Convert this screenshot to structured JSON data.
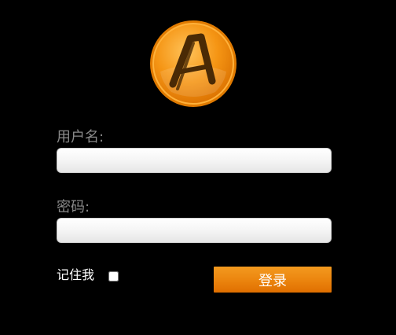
{
  "logo": {
    "icon": "letter-a-orange-logo",
    "letter": "A",
    "accent": "#f39a1f"
  },
  "form": {
    "username_label": "用户名:",
    "username_value": "",
    "password_label": "密码:",
    "password_value": "",
    "remember_label": "记住我",
    "remember_checked": false,
    "login_button": "登录"
  },
  "colors": {
    "background": "#000000",
    "label": "#8a8a8a",
    "button_top": "#f39a1f",
    "button_bottom": "#e06f00"
  }
}
